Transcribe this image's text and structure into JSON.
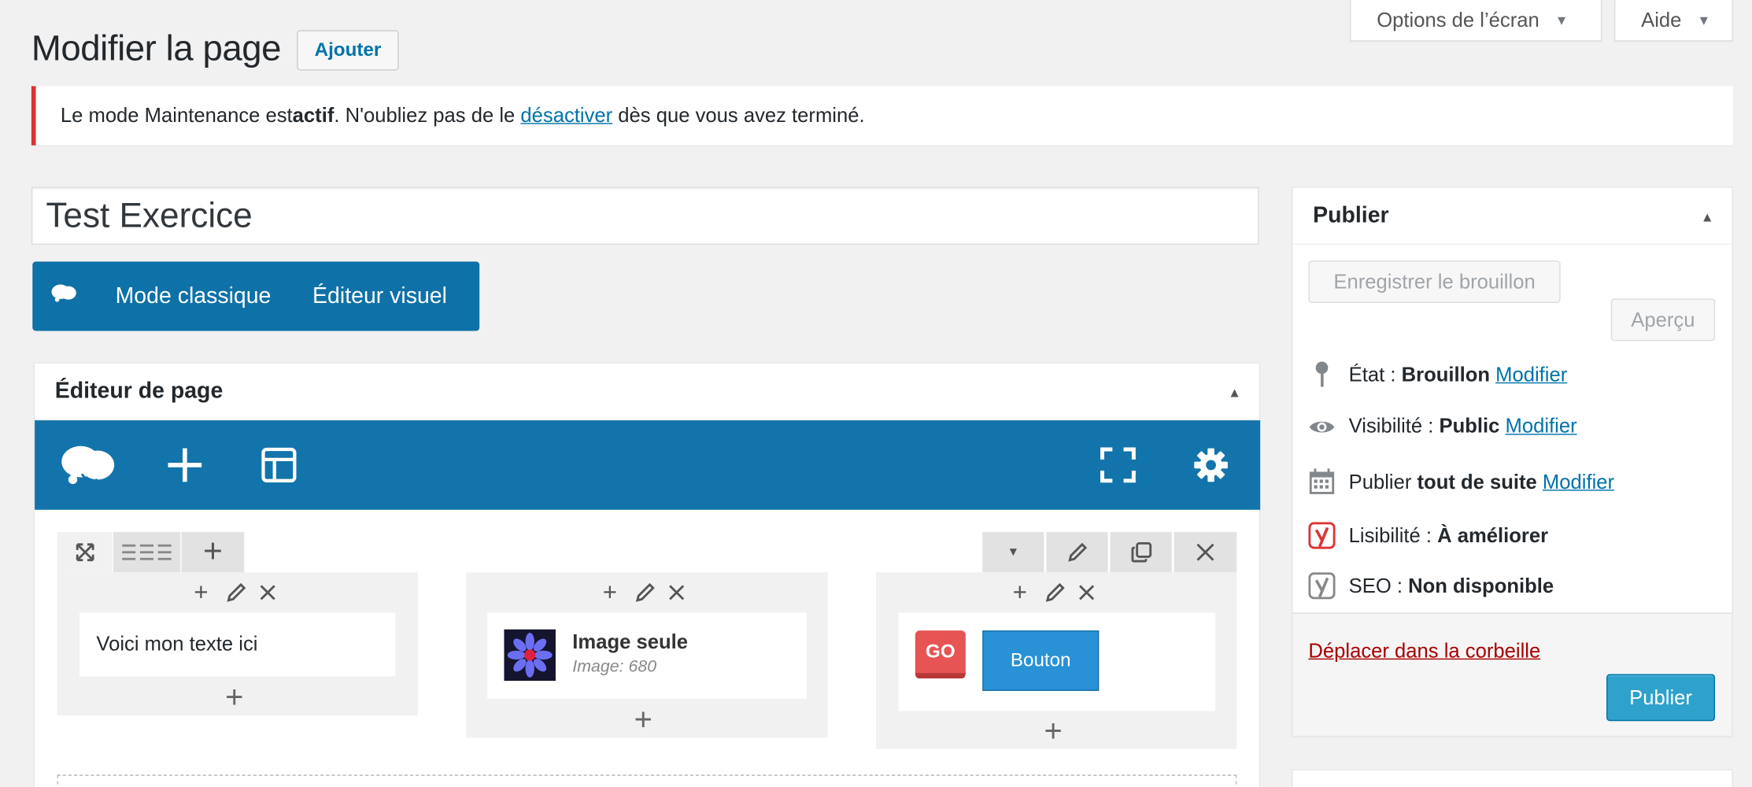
{
  "screen_options": {
    "options_label": "Options de l’écran",
    "help_label": "Aide"
  },
  "header": {
    "title": "Modifier la page",
    "add_label": "Ajouter"
  },
  "notice": {
    "text_before": "Le mode Maintenance est ",
    "strong": "actif",
    "text_mid": ". N'oubliez pas de le ",
    "link": "désactiver",
    "text_after": " dès que vous avez terminé."
  },
  "post": {
    "title": "Test Exercice"
  },
  "mode_bar": {
    "classic": "Mode classique",
    "visual": "Éditeur visuel"
  },
  "page_editor": {
    "title": "Éditeur de page",
    "widgets": {
      "text": "Voici mon texte ici",
      "image_title": "Image seule",
      "image_sub": "Image: 680",
      "go_badge": "GO",
      "button_label": "Bouton"
    }
  },
  "publish": {
    "title": "Publier",
    "save_draft": "Enregistrer le brouillon",
    "preview": "Aperçu",
    "status_label": "État :",
    "status_value": "Brouillon",
    "visibility_label": "Visibilité :",
    "visibility_value": "Public",
    "publish_label": "Publier",
    "publish_value": "tout de suite",
    "modify": "Modifier",
    "readability_label": "Lisibilité :",
    "readability_value": "À améliorer",
    "seo_label": "SEO :",
    "seo_value": "Non disponible",
    "trash": "Déplacer dans la corbeille",
    "publish_button": "Publier"
  },
  "colors": {
    "accent": "#0e71a8",
    "notice_error": "#dc3232",
    "link": "#0073aa",
    "trash": "#a00",
    "publish_btn": "#2ea2cc",
    "yoast_bad": "#dc3232"
  }
}
